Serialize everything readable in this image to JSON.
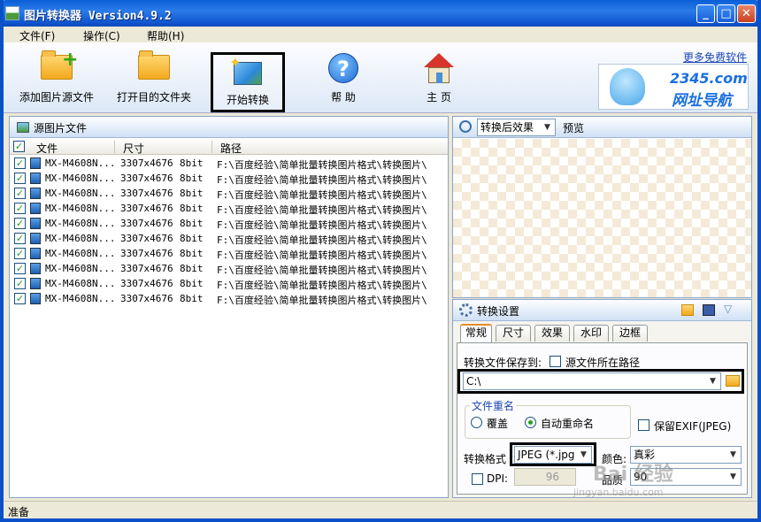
{
  "window": {
    "title": "图片转换器 Version4.9.2",
    "controls": [
      "minimize",
      "maximize",
      "close"
    ]
  },
  "menu": [
    {
      "label": "文件(F)"
    },
    {
      "label": "操作(C)"
    },
    {
      "label": "帮助(H)"
    }
  ],
  "toolbar": [
    {
      "label": "添加图片源文件",
      "icon": "add-folder-icon"
    },
    {
      "label": "打开目的文件夹",
      "icon": "folder-icon"
    },
    {
      "label": "开始转换",
      "icon": "magic-wand-icon",
      "highlighted": true
    },
    {
      "label": "帮 助",
      "icon": "help-icon"
    },
    {
      "label": "主 页",
      "icon": "home-icon"
    }
  ],
  "ad": {
    "link": "更多免费软件",
    "domain": "2345.com",
    "tagline": "网址导航"
  },
  "source_panel": {
    "title": "源图片文件",
    "columns": [
      "文件",
      "尺寸",
      "路径"
    ],
    "rows": [
      {
        "file": "MX-M4608N...",
        "size": "3307x4676",
        "depth": "8bit",
        "path": "F:\\百度经验\\简单批量转换图片格式\\转换图片\\",
        "checked": true
      },
      {
        "file": "MX-M4608N...",
        "size": "3307x4676",
        "depth": "8bit",
        "path": "F:\\百度经验\\简单批量转换图片格式\\转换图片\\",
        "checked": true
      },
      {
        "file": "MX-M4608N...",
        "size": "3307x4676",
        "depth": "8bit",
        "path": "F:\\百度经验\\简单批量转换图片格式\\转换图片\\",
        "checked": true
      },
      {
        "file": "MX-M4608N...",
        "size": "3307x4676",
        "depth": "8bit",
        "path": "F:\\百度经验\\简单批量转换图片格式\\转换图片\\",
        "checked": true
      },
      {
        "file": "MX-M4608N...",
        "size": "3307x4676",
        "depth": "8bit",
        "path": "F:\\百度经验\\简单批量转换图片格式\\转换图片\\",
        "checked": true
      },
      {
        "file": "MX-M4608N...",
        "size": "3307x4676",
        "depth": "8bit",
        "path": "F:\\百度经验\\简单批量转换图片格式\\转换图片\\",
        "checked": true
      },
      {
        "file": "MX-M4608N...",
        "size": "3307x4676",
        "depth": "8bit",
        "path": "F:\\百度经验\\简单批量转换图片格式\\转换图片\\",
        "checked": true
      },
      {
        "file": "MX-M4608N...",
        "size": "3307x4676",
        "depth": "8bit",
        "path": "F:\\百度经验\\简单批量转换图片格式\\转换图片\\",
        "checked": true
      },
      {
        "file": "MX-M4608N...",
        "size": "3307x4676",
        "depth": "8bit",
        "path": "F:\\百度经验\\简单批量转换图片格式\\转换图片\\",
        "checked": true
      },
      {
        "file": "MX-M4608N...",
        "size": "3307x4676",
        "depth": "8bit",
        "path": "F:\\百度经验\\简单批量转换图片格式\\转换图片\\",
        "checked": true
      }
    ]
  },
  "preview_panel": {
    "view_select": "转换后效果",
    "preview_label": "预览"
  },
  "settings_panel": {
    "title": "转换设置",
    "tabs": [
      "常规",
      "尺寸",
      "效果",
      "水印",
      "边框"
    ],
    "active_tab": "常规",
    "save_to_label": "转换文件保存到:",
    "source_path_label": "源文件所在路径",
    "source_path_checked": false,
    "save_path": "C:\\",
    "rename_group_label": "文件重名",
    "rename_options": [
      {
        "label": "覆盖",
        "selected": false
      },
      {
        "label": "自动重命名",
        "selected": true
      }
    ],
    "keep_exif_label": "保留EXIF(JPEG)",
    "keep_exif_checked": false,
    "format_label": "转换格式",
    "format_value": "JPEG (*.jpg",
    "color_label": "颜色:",
    "color_value": "真彩",
    "dpi_label": "DPI:",
    "dpi_checked": false,
    "dpi_value": "96",
    "quality_label": "品质",
    "quality_value": "90"
  },
  "watermark": {
    "main": "Bai 经验",
    "sub": "jingyan.baidu.com"
  },
  "status": {
    "text": "准备"
  },
  "colors": {
    "titlebar": "#0a5fd8",
    "highlight_border": "#000000",
    "active_tab_accent": "#e68b2c",
    "link": "#1f47b5"
  }
}
